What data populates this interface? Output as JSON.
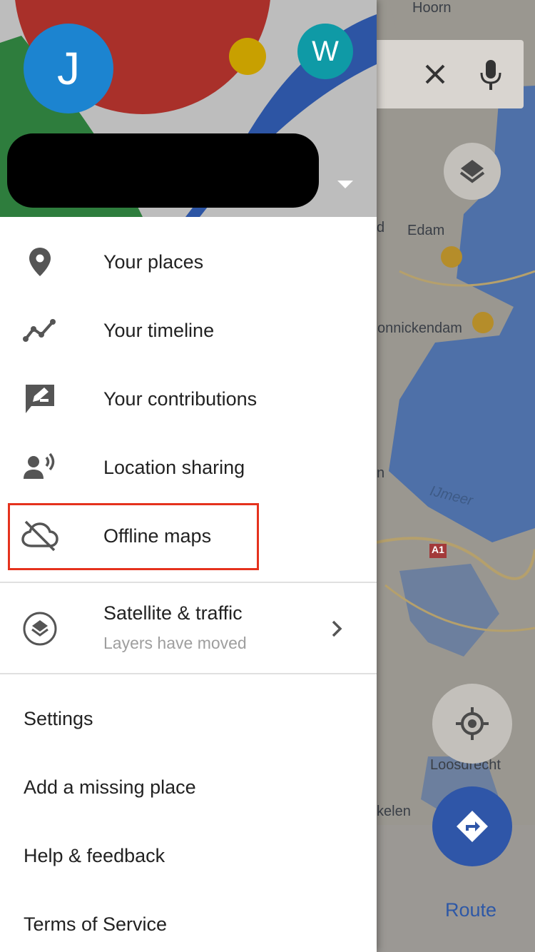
{
  "header": {
    "avatar_initial": "J",
    "secondary_avatar_initial": "W"
  },
  "menu": {
    "items": [
      {
        "label": "Your places",
        "icon": "place-pin-icon"
      },
      {
        "label": "Your timeline",
        "icon": "timeline-icon"
      },
      {
        "label": "Your contributions",
        "icon": "contributions-icon"
      },
      {
        "label": "Location sharing",
        "icon": "location-sharing-icon"
      },
      {
        "label": "Offline maps",
        "icon": "cloud-off-icon"
      }
    ],
    "layers_item": {
      "label": "Satellite & traffic",
      "sublabel": "Layers have moved",
      "icon": "layers-icon"
    },
    "text_items": [
      "Settings",
      "Add a missing place",
      "Help & feedback",
      "Terms of Service"
    ]
  },
  "map": {
    "labels": [
      "Hoorn",
      "Edam",
      "onnickendam",
      "IJmeer",
      "Loosdrecht",
      "kelen",
      "d",
      "n"
    ],
    "road_badge": "A1"
  },
  "route": {
    "label": "Route"
  },
  "colors": {
    "highlight": "#e5321d",
    "avatar_main": "#1c84d0",
    "avatar_alt": "#0f9aa6",
    "route_button": "#2f56a8"
  }
}
